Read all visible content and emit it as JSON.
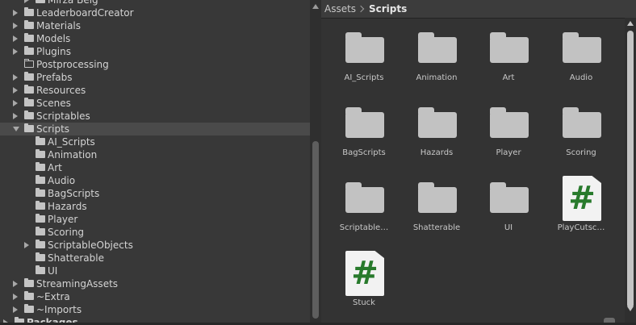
{
  "tree": {
    "items": [
      {
        "label": "Mirza Beig",
        "arrow": "collapsed",
        "indent": 1,
        "icon": "folder"
      },
      {
        "label": "LeaderboardCreator",
        "arrow": "collapsed",
        "indent": 0,
        "icon": "folder"
      },
      {
        "label": "Materials",
        "arrow": "collapsed",
        "indent": 0,
        "icon": "folder"
      },
      {
        "label": "Models",
        "arrow": "collapsed",
        "indent": 0,
        "icon": "folder"
      },
      {
        "label": "Plugins",
        "arrow": "collapsed",
        "indent": 0,
        "icon": "folder"
      },
      {
        "label": "Postprocessing",
        "arrow": "none",
        "indent": 0,
        "icon": "folder-empty"
      },
      {
        "label": "Prefabs",
        "arrow": "collapsed",
        "indent": 0,
        "icon": "folder"
      },
      {
        "label": "Resources",
        "arrow": "collapsed",
        "indent": 0,
        "icon": "folder"
      },
      {
        "label": "Scenes",
        "arrow": "collapsed",
        "indent": 0,
        "icon": "folder"
      },
      {
        "label": "Scriptables",
        "arrow": "collapsed",
        "indent": 0,
        "icon": "folder"
      },
      {
        "label": "Scripts",
        "arrow": "expanded",
        "indent": 0,
        "icon": "folder-open",
        "selected": true
      },
      {
        "label": "AI_Scripts",
        "arrow": "none",
        "indent": 1,
        "icon": "folder"
      },
      {
        "label": "Animation",
        "arrow": "none",
        "indent": 1,
        "icon": "folder"
      },
      {
        "label": "Art",
        "arrow": "none",
        "indent": 1,
        "icon": "folder"
      },
      {
        "label": "Audio",
        "arrow": "none",
        "indent": 1,
        "icon": "folder"
      },
      {
        "label": "BagScripts",
        "arrow": "none",
        "indent": 1,
        "icon": "folder"
      },
      {
        "label": "Hazards",
        "arrow": "none",
        "indent": 1,
        "icon": "folder"
      },
      {
        "label": "Player",
        "arrow": "none",
        "indent": 1,
        "icon": "folder"
      },
      {
        "label": "Scoring",
        "arrow": "none",
        "indent": 1,
        "icon": "folder"
      },
      {
        "label": "ScriptableObjects",
        "arrow": "collapsed",
        "indent": 1,
        "icon": "folder"
      },
      {
        "label": "Shatterable",
        "arrow": "none",
        "indent": 1,
        "icon": "folder"
      },
      {
        "label": "UI",
        "arrow": "none",
        "indent": 1,
        "icon": "folder"
      },
      {
        "label": "StreamingAssets",
        "arrow": "collapsed",
        "indent": 0,
        "icon": "folder"
      },
      {
        "label": "~Extra",
        "arrow": "collapsed",
        "indent": 0,
        "icon": "folder"
      },
      {
        "label": "~Imports",
        "arrow": "collapsed",
        "indent": 0,
        "icon": "folder"
      },
      {
        "label": "Packages",
        "arrow": "collapsed",
        "indent": -1,
        "icon": "folder",
        "packages": true
      }
    ]
  },
  "breadcrumb": {
    "root": "Assets",
    "current": "Scripts"
  },
  "assets": {
    "items": [
      {
        "label": "AI_Scripts",
        "type": "folder"
      },
      {
        "label": "Animation",
        "type": "folder"
      },
      {
        "label": "Art",
        "type": "folder"
      },
      {
        "label": "Audio",
        "type": "folder"
      },
      {
        "label": "BagScripts",
        "type": "folder"
      },
      {
        "label": "Hazards",
        "type": "folder"
      },
      {
        "label": "Player",
        "type": "folder"
      },
      {
        "label": "Scoring",
        "type": "folder"
      },
      {
        "label": "Scriptable…",
        "type": "folder"
      },
      {
        "label": "Shatterable",
        "type": "folder"
      },
      {
        "label": "UI",
        "type": "folder"
      },
      {
        "label": "PlayCutsc…",
        "type": "script"
      },
      {
        "label": "Stuck",
        "type": "script"
      }
    ],
    "script_glyph": "#"
  },
  "colors": {
    "script_hash": "#287a2c",
    "folder": "#c2c2c2",
    "selection": "#4a4a4a"
  }
}
